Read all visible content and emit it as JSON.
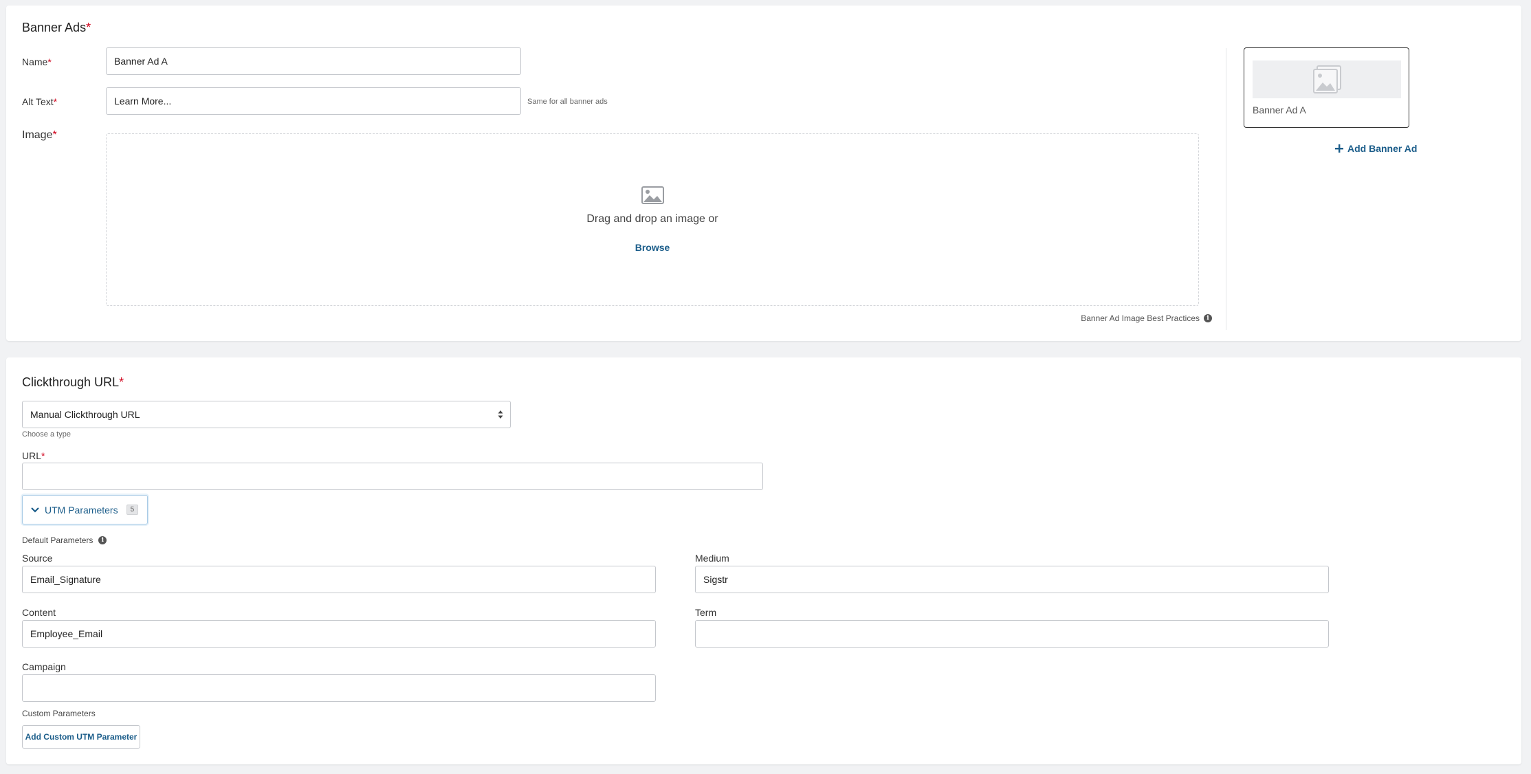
{
  "banner_ads": {
    "title": "Banner Ads",
    "required_mark": "*",
    "name_label": "Name",
    "name_value": "Banner Ad A",
    "alt_text_label": "Alt Text",
    "alt_text_value": "Learn More...",
    "alt_text_hint": "Same for all banner ads",
    "image_label": "Image",
    "dropzone_text": "Drag and drop an image or",
    "browse_label": "Browse",
    "best_practices_label": "Banner Ad Image Best Practices",
    "thumbnail_label": "Banner Ad A",
    "add_banner_label": "Add Banner Ad"
  },
  "clickthrough": {
    "title": "Clickthrough URL",
    "required_mark": "*",
    "type_value": "Manual Clickthrough URL",
    "type_hint": "Choose a type",
    "url_label": "URL",
    "url_value": "",
    "utm_toggle_label": "UTM Parameters",
    "utm_count": "5",
    "default_params_label": "Default Parameters",
    "source_label": "Source",
    "source_value": "Email_Signature",
    "medium_label": "Medium",
    "medium_value": "Sigstr",
    "content_label": "Content",
    "content_value": "Employee_Email",
    "term_label": "Term",
    "term_value": "",
    "campaign_label": "Campaign",
    "campaign_value": "",
    "custom_params_label": "Custom Parameters",
    "add_custom_label": "Add Custom UTM Parameter"
  },
  "colors": {
    "accent": "#1b5d8a",
    "required": "#d0021b",
    "background": "#f1f2f4"
  },
  "icons": {
    "dropzone": "image-icon",
    "thumbnail": "image-placeholder-icon",
    "add": "plus-icon",
    "info": "info-icon",
    "utm_toggle": "chevron-down-icon",
    "select": "sort-arrows-icon"
  }
}
